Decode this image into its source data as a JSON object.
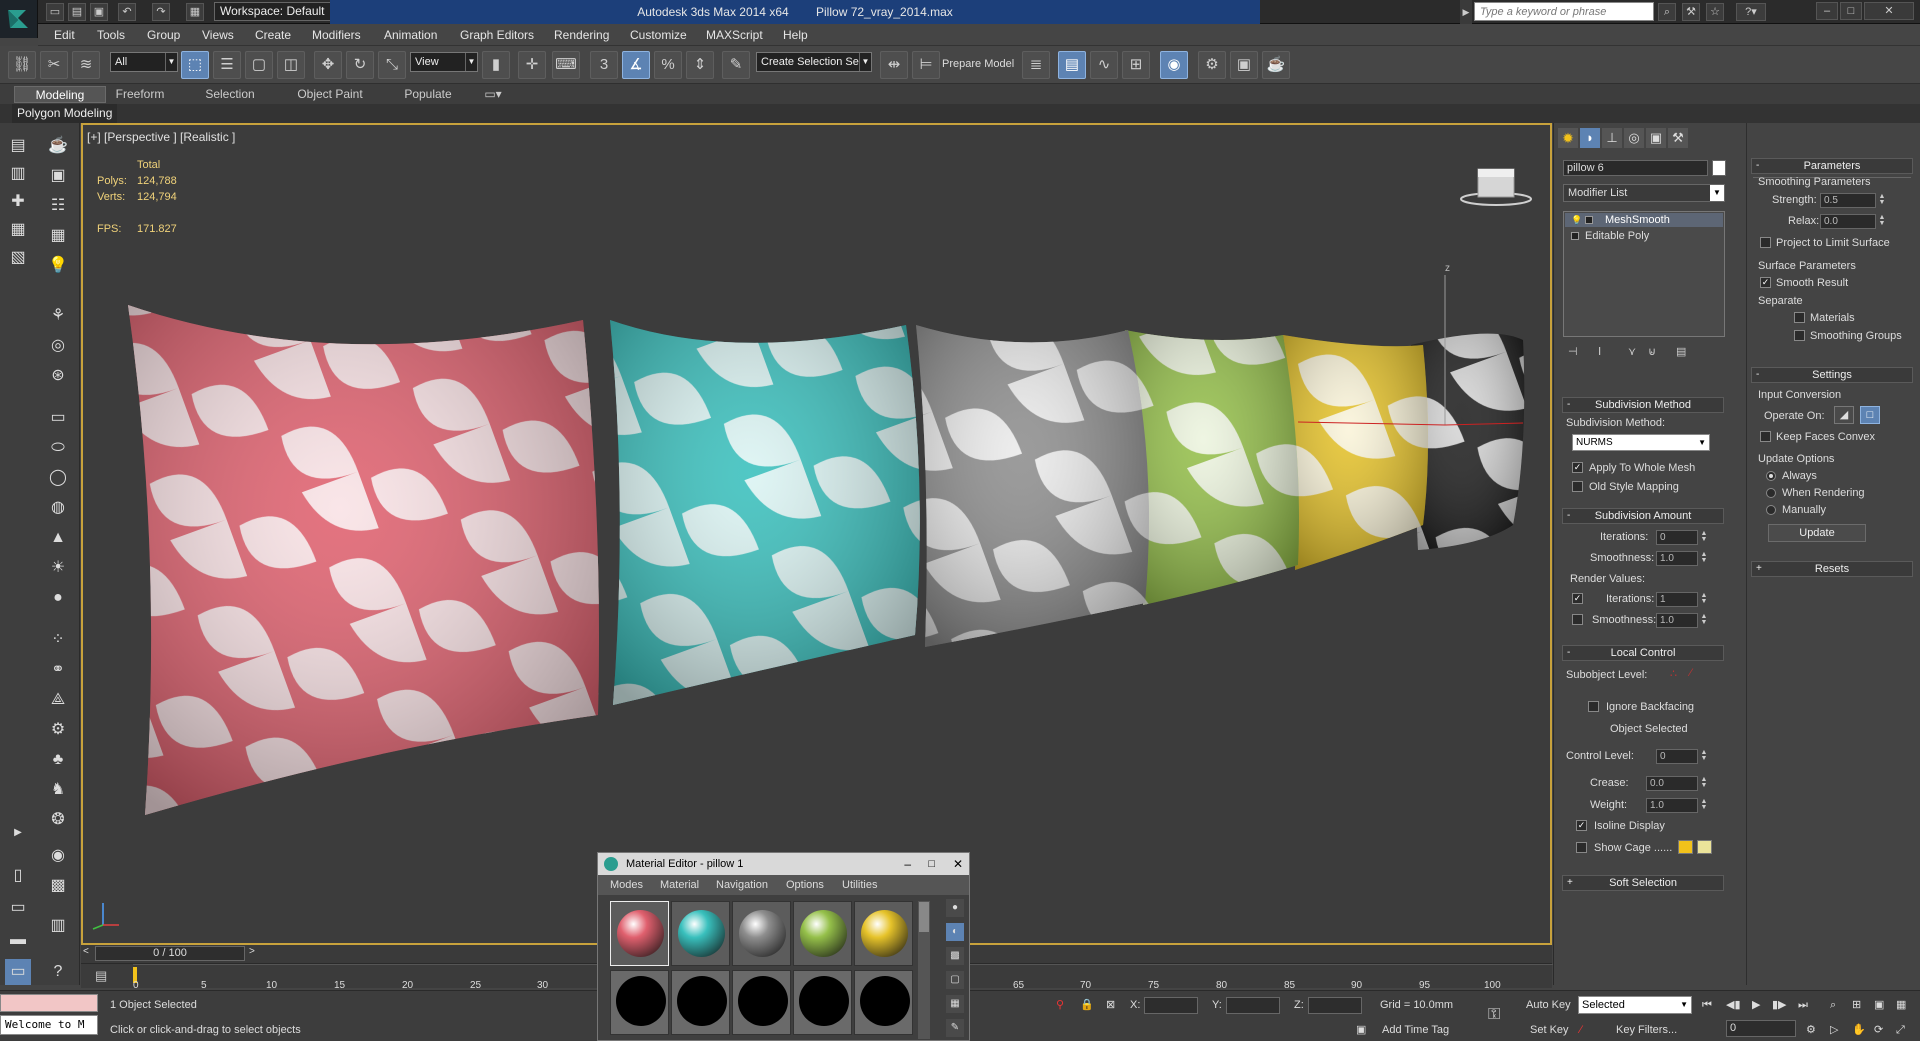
{
  "app": {
    "title": "Autodesk 3ds Max  2014 x64",
    "file": "Pillow 72_vray_2014.max",
    "workspace": "Workspace: Default",
    "search_placeholder": "Type a keyword or phrase"
  },
  "menu": [
    "Edit",
    "Tools",
    "Group",
    "Views",
    "Create",
    "Modifiers",
    "Animation",
    "Graph Editors",
    "Rendering",
    "Customize",
    "MAXScript",
    "Help"
  ],
  "toolbar": {
    "selection_filter": "All",
    "ref_coord": "View",
    "prepare_model": "Prepare Model",
    "named_selection": "Create Selection Se"
  },
  "ribbon": {
    "tabs": [
      "Modeling",
      "Freeform",
      "Selection",
      "Object Paint",
      "Populate"
    ],
    "active_tab": "Modeling",
    "panel_label": "Polygon Modeling"
  },
  "viewport": {
    "label": "[+] [Perspective ] [Realistic ]",
    "stats": {
      "total_label": "Total",
      "polys_label": "Polys:",
      "polys": "124,788",
      "verts_label": "Verts:",
      "verts": "124,794",
      "fps_label": "FPS:",
      "fps": "171.827"
    },
    "axis_z": "z",
    "gizmo_labels": {
      "z": "z",
      "x": "x",
      "y": "y"
    },
    "pillows": [
      {
        "color": "#e0606e",
        "name": "pillow-red"
      },
      {
        "color": "#39c0bd",
        "name": "pillow-teal"
      },
      {
        "color": "#8e8e8e",
        "name": "pillow-gray"
      },
      {
        "color": "#95c04a",
        "name": "pillow-green"
      },
      {
        "color": "#e6c32a",
        "name": "pillow-yellow"
      },
      {
        "color": "#1e1e1e",
        "name": "pillow-black"
      }
    ]
  },
  "command_panel": {
    "object_name": "pillow 6",
    "modifier_list_label": "Modifier List",
    "stack": [
      "MeshSmooth",
      "Editable Poly"
    ],
    "subdivision_method": {
      "header": "Subdivision Method",
      "label": "Subdivision Method:",
      "value": "NURMS",
      "apply_whole_mesh": "Apply To Whole Mesh",
      "old_style_mapping": "Old Style Mapping"
    },
    "subdivision_amount": {
      "header": "Subdivision Amount",
      "iterations_label": "Iterations:",
      "iterations": "0",
      "smoothness_label": "Smoothness:",
      "smoothness": "1.0",
      "render_values": "Render Values:",
      "render_iterations_label": "Iterations:",
      "render_iterations": "1",
      "render_smoothness_label": "Smoothness:",
      "render_smoothness": "1.0"
    },
    "local_control": {
      "header": "Local Control",
      "subobject_level": "Subobject Level:",
      "ignore_backfacing": "Ignore Backfacing",
      "object_selected": "Object Selected",
      "control_level_label": "Control Level:",
      "control_level": "0",
      "crease_label": "Crease:",
      "crease": "0.0",
      "weight_label": "Weight:",
      "weight": "1.0",
      "isoline_display": "Isoline Display",
      "show_cage": "Show Cage ......",
      "cage_colors": [
        "#f2c21b",
        "#ebe39a"
      ]
    },
    "soft_selection": "Soft Selection",
    "parameters": {
      "header": "Parameters",
      "smoothing_parameters": "Smoothing Parameters",
      "strength_label": "Strength:",
      "strength": "0.5",
      "relax_label": "Relax:",
      "relax": "0.0",
      "project_to_limit": "Project to Limit Surface",
      "surface_parameters": "Surface Parameters",
      "smooth_result": "Smooth Result",
      "separate": "Separate",
      "materials": "Materials",
      "smoothing_groups": "Smoothing Groups"
    },
    "settings": {
      "header": "Settings",
      "input_conversion": "Input Conversion",
      "operate_on": "Operate On:",
      "keep_faces_convex": "Keep Faces Convex",
      "update_options": "Update Options",
      "always": "Always",
      "when_rendering": "When Rendering",
      "manually": "Manually",
      "update_button": "Update"
    },
    "resets": "Resets"
  },
  "timeline": {
    "frame_display": "0 / 100",
    "ticks": [
      "0",
      "5",
      "10",
      "15",
      "20",
      "25",
      "30",
      "65",
      "70",
      "75",
      "80",
      "85",
      "90",
      "95",
      "100"
    ]
  },
  "status": {
    "welcome": "Welcome to M",
    "selection": "1 Object Selected",
    "prompt": "Click or click-and-drag to select objects",
    "x_label": "X:",
    "y_label": "Y:",
    "z_label": "Z:",
    "grid": "Grid = 10.0mm",
    "add_time_tag": "Add Time Tag",
    "auto_key": "Auto Key",
    "set_key": "Set Key",
    "key_mode": "Selected",
    "key_filters": "Key Filters...",
    "frame": "0"
  },
  "material_editor": {
    "title": "Material Editor - pillow 1",
    "menu": [
      "Modes",
      "Material",
      "Navigation",
      "Options",
      "Utilities"
    ],
    "slots": [
      "#e0606e",
      "#39c0bd",
      "#8e8e8e",
      "#95c04a",
      "#e6c32a"
    ]
  }
}
